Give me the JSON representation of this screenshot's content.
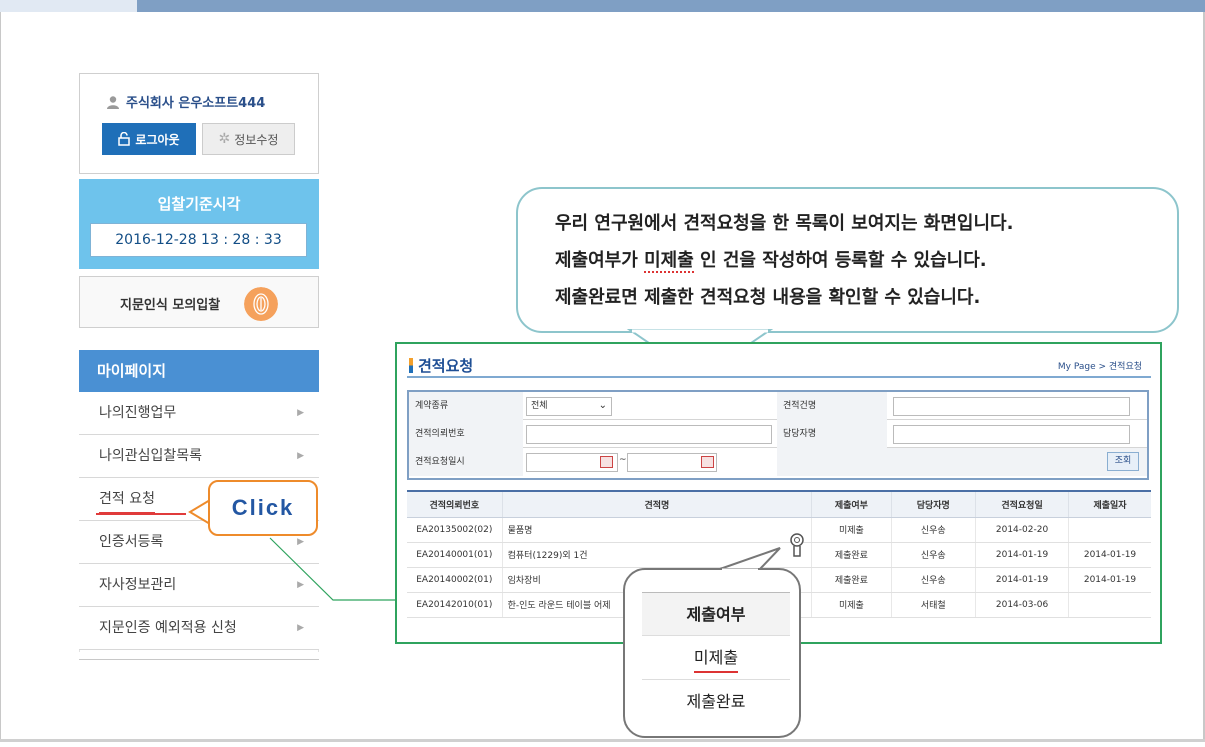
{
  "user": {
    "company": "주식회사 은우소프트444",
    "logout_label": "로그아웃",
    "edit_label": "정보수정"
  },
  "bid_time": {
    "title": "입찰기준시각",
    "value": "2016-12-28 13 : 28 : 33"
  },
  "fingerprint": {
    "label": "지문인식 모의입찰"
  },
  "sidebar": {
    "title": "마이페이지",
    "items": [
      {
        "label": "나의진행업무",
        "arrow": "▶"
      },
      {
        "label": "나의관심입찰목록",
        "arrow": "▶"
      },
      {
        "label": "견적 요청",
        "arrow": ""
      },
      {
        "label": "인증서등록",
        "arrow": "▶"
      },
      {
        "label": "자사정보관리",
        "arrow": "▶"
      },
      {
        "label": "지문인증 예외적용 신청",
        "arrow": "▶"
      }
    ]
  },
  "click_label": "Click",
  "bubble": {
    "line1": "우리 연구원에서 견적요청을 한 목록이 보여지는 화면입니다.",
    "line2_a": "제출여부가 ",
    "line2_u": "미제출",
    "line2_b": " 인 건을 작성하여 등록할 수 있습니다.",
    "line3": "제출완료면 제출한 견적요청 내용을 확인할 수 있습니다."
  },
  "panel": {
    "title": "견적요청",
    "breadcrumb": "My Page > 견적요청"
  },
  "search": {
    "contract_type_label": "계약종류",
    "contract_type_value": "전체",
    "estimate_name_label": "견적건명",
    "request_no_label": "견적의뢰번호",
    "manager_label": "담당자명",
    "request_date_label": "견적요청일시",
    "tilde": "~",
    "search_button": "조회"
  },
  "table": {
    "headers": [
      "견적의뢰번호",
      "견적명",
      "제출여부",
      "담당자명",
      "견적요청일",
      "제출일자"
    ],
    "rows": [
      [
        "EA20135002(02)",
        "물품명",
        "미제출",
        "신우송",
        "2014-02-20",
        ""
      ],
      [
        "EA20140001(01)",
        "컴퓨터(1229)외 1건",
        "제출완료",
        "신우송",
        "2014-01-19",
        "2014-01-19"
      ],
      [
        "EA20140002(01)",
        "임차장비",
        "제출완료",
        "신우송",
        "2014-01-19",
        "2014-01-19"
      ],
      [
        "EA20142010(01)",
        "한-인도 라운드 테이블 어제",
        "미제출",
        "서태철",
        "2014-03-06",
        ""
      ]
    ]
  },
  "zoom": {
    "header": "제출여부",
    "value1": "미제출",
    "value2": "제출완료"
  }
}
